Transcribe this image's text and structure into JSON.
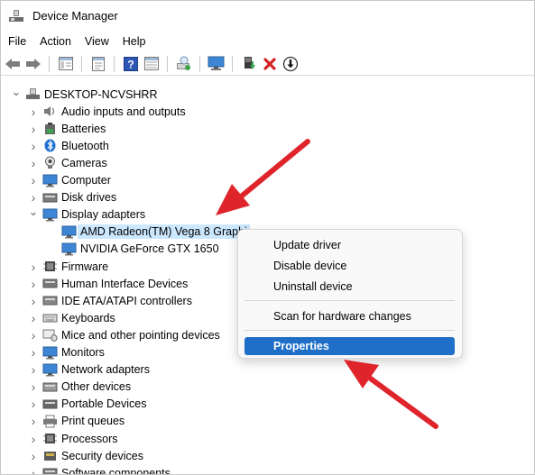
{
  "window": {
    "title": "Device Manager"
  },
  "menu": [
    "File",
    "Action",
    "View",
    "Help"
  ],
  "toolbar": {
    "icons": [
      "back-arrow-icon",
      "forward-arrow-icon",
      "show-hide-tree-icon",
      "properties-sheet-icon",
      "help-icon",
      "console-view-icon",
      "scan-hardware-icon",
      "monitor-display-icon",
      "update-driver-icon",
      "uninstall-device-icon",
      "disable-device-icon"
    ]
  },
  "tree": {
    "root": "DESKTOP-NCVSHRR",
    "categories": [
      {
        "label": "Audio inputs and outputs",
        "icon": "speaker-icon"
      },
      {
        "label": "Batteries",
        "icon": "battery-icon"
      },
      {
        "label": "Bluetooth",
        "icon": "bluetooth-icon"
      },
      {
        "label": "Cameras",
        "icon": "camera-icon"
      },
      {
        "label": "Computer",
        "icon": "computer-icon"
      },
      {
        "label": "Disk drives",
        "icon": "disk-drive-icon"
      },
      {
        "label": "Display adapters",
        "icon": "display-adapter-icon",
        "expanded": true,
        "children": [
          "AMD Radeon(TM) Vega 8 Graphi",
          "NVIDIA GeForce GTX 1650"
        ]
      },
      {
        "label": "Firmware",
        "icon": "firmware-icon"
      },
      {
        "label": "Human Interface Devices",
        "icon": "hid-icon"
      },
      {
        "label": "IDE ATA/ATAPI controllers",
        "icon": "ide-controller-icon"
      },
      {
        "label": "Keyboards",
        "icon": "keyboard-icon"
      },
      {
        "label": "Mice and other pointing devices",
        "icon": "mouse-icon"
      },
      {
        "label": "Monitors",
        "icon": "monitor-icon"
      },
      {
        "label": "Network adapters",
        "icon": "network-adapter-icon"
      },
      {
        "label": "Other devices",
        "icon": "other-devices-icon"
      },
      {
        "label": "Portable Devices",
        "icon": "portable-devices-icon"
      },
      {
        "label": "Print queues",
        "icon": "printer-icon"
      },
      {
        "label": "Processors",
        "icon": "processor-icon"
      },
      {
        "label": "Security devices",
        "icon": "security-icon"
      },
      {
        "label": "Software components",
        "icon": "software-component-icon"
      }
    ]
  },
  "context_menu": {
    "items": [
      "Update driver",
      "Disable device",
      "Uninstall device",
      "Scan for hardware changes",
      "Properties"
    ],
    "active": "Properties"
  },
  "colors": {
    "accent": "#1f6fc8",
    "selection": "#cce8ff",
    "annotation_arrow": "#e0242b"
  }
}
